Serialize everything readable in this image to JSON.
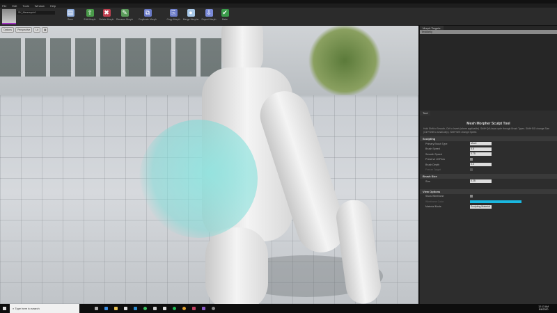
{
  "menu": [
    "File",
    "Edit",
    "Tools",
    "Window",
    "Help"
  ],
  "asset": "SK_Mannequin1",
  "toolbar": [
    {
      "label": "Save",
      "icon": "save-icon",
      "color": "#8aa8d8",
      "glyph": "▤"
    },
    {
      "label": "Edit Morph",
      "icon": "edit-morph-icon",
      "color": "#4a9a4a",
      "glyph": "⇧"
    },
    {
      "label": "Delete Morph",
      "icon": "delete-morph-icon",
      "color": "#c04050",
      "glyph": "✖"
    },
    {
      "label": "Rename Morph",
      "icon": "rename-morph-icon",
      "color": "#5a9a5a",
      "glyph": "✎"
    },
    {
      "label": "Duplicate Morph",
      "icon": "duplicate-morph-icon",
      "color": "#6a7ac8",
      "glyph": "⧉"
    },
    {
      "label": "Copy Morph",
      "icon": "copy-morph-icon",
      "color": "#6a7ac8",
      "glyph": "⎘"
    },
    {
      "label": "Merge Morphs",
      "icon": "merge-morphs-icon",
      "color": "#a8c8e8",
      "glyph": "●"
    },
    {
      "label": "Export Morph",
      "icon": "export-morph-icon",
      "color": "#7a8ad8",
      "glyph": "⇩"
    },
    {
      "label": "Bake",
      "icon": "bake-icon",
      "color": "#3a9a4a",
      "glyph": "✔"
    }
  ],
  "viewport": {
    "options": "Options",
    "perspective": "Perspective",
    "lit": "Lit"
  },
  "morph_targets": {
    "tab": "Morph Targets",
    "items": [
      "TestBelly"
    ]
  },
  "tool": {
    "tab": "Tool",
    "title": "Mesh Morpher Sculpt Tool",
    "help": "Hold Shift to Smooth, Ctrl to Invert (where applicable). Shift+Q/A keys cycle through Brush Types. Shift+S/D change Size (Ctrl+Shift to small-step). Shift+W/E change Speed.",
    "sculpting": {
      "header": "Sculpting",
      "primary_brush_type_label": "Primary Brush Type",
      "primary_brush_type": "Move",
      "brush_speed_label": "Brush Speed",
      "brush_speed": "0.5",
      "smooth_speed_label": "Smooth Speed",
      "smooth_speed": "0.75",
      "preserve_uv_label": "Preserve UVFlow",
      "brush_depth_label": "Brush Depth",
      "brush_depth": "0.0",
      "freeze_target_label": "Freeze Target"
    },
    "brush_size": {
      "header": "Brush Size",
      "size_label": "Size",
      "size": "0.25"
    },
    "view_options": {
      "header": "View Options",
      "show_wireframe_label": "Show Wireframe",
      "wireframe_color_label": "Wireframe Color",
      "wireframe_color": "#1ab8e0",
      "material_mode_label": "Material Mode",
      "material_mode": "Sculpting Material"
    }
  },
  "taskbar": {
    "search_placeholder": "Type here to search",
    "time": "12:13 AM",
    "date": "5/6/2020"
  }
}
